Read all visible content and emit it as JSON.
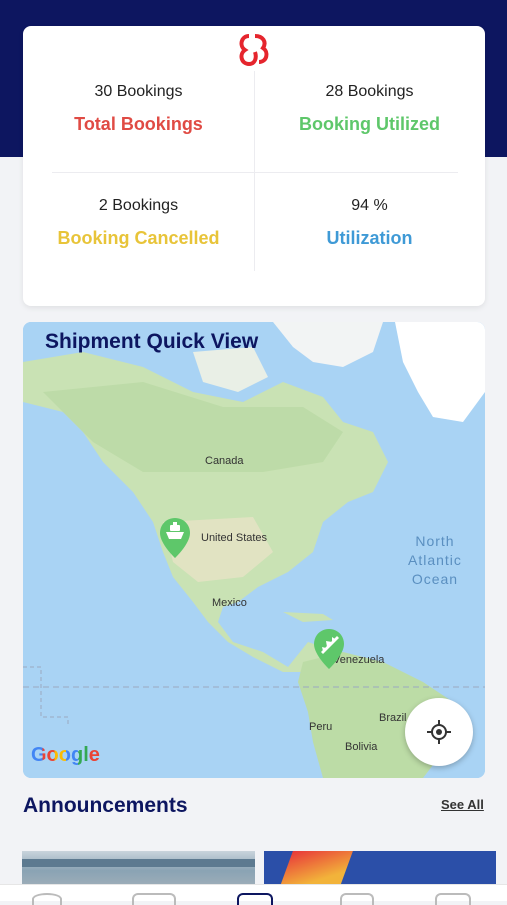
{
  "stats": [
    {
      "count": "30 Bookings",
      "label": "Total Bookings",
      "color": "#e04b44"
    },
    {
      "count": "28 Bookings",
      "label": "Booking Utilized",
      "color": "#5ec76a"
    },
    {
      "count": "2 Bookings",
      "label": "Booking Cancelled",
      "color": "#e8c439"
    },
    {
      "count": "94 %",
      "label": "Utilization",
      "color": "#3f9ad6"
    }
  ],
  "map": {
    "title": "Shipment Quick View",
    "labels": {
      "canada": "Canada",
      "united_states": "United States",
      "mexico": "Mexico",
      "venezuela": "Venezuela",
      "peru": "Peru",
      "brazil": "Brazil",
      "bolivia": "Bolivia"
    },
    "ocean_lines": [
      "North",
      "Atlantic",
      "Ocean"
    ],
    "attribution": "Google",
    "markers": [
      {
        "type": "ship-icon",
        "color": "#5ec76a"
      },
      {
        "type": "plane-icon",
        "color": "#5ec76a"
      }
    ]
  },
  "announcements": {
    "title": "Announcements",
    "see_all": "See All"
  },
  "colors": {
    "header": "#0d1660",
    "accent_red": "#e04b44"
  }
}
